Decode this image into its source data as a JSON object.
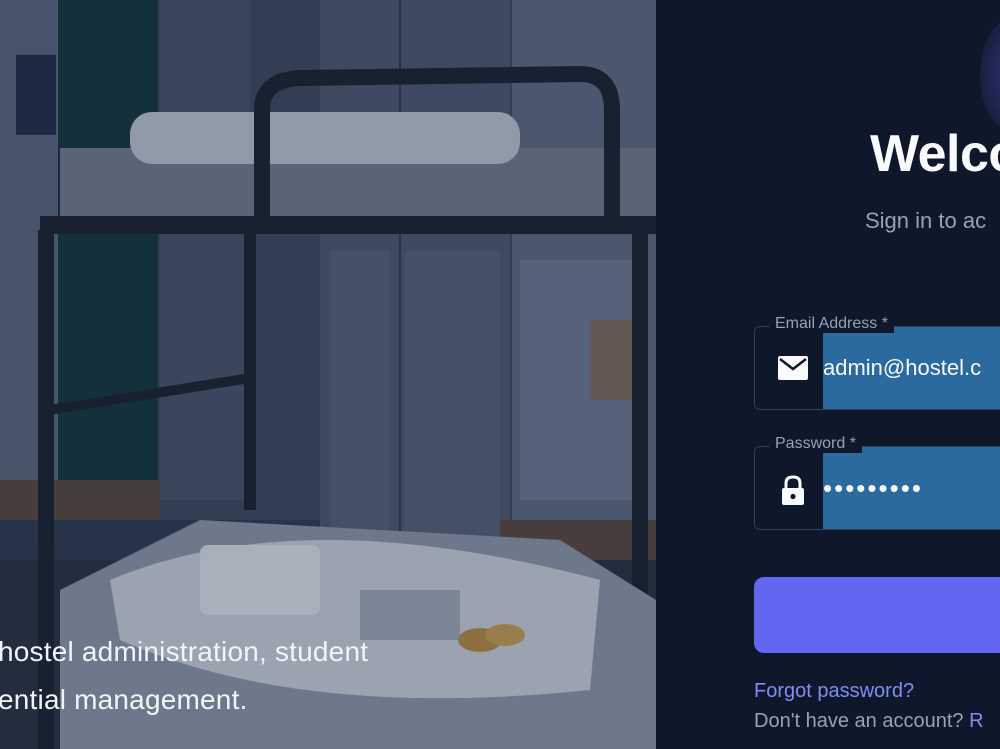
{
  "hero": {
    "caption_line1": "hostel administration, student",
    "caption_line2": "ential management."
  },
  "auth": {
    "title": "Welco",
    "subtitle": "Sign in to ac",
    "email": {
      "label": "Email Address *",
      "value": "admin@hostel.c",
      "icon": "mail-icon"
    },
    "password": {
      "label": "Password *",
      "value": "•••••••••",
      "icon": "lock-icon"
    },
    "submit_label": "",
    "forgot_label": "Forgot password?",
    "signup_prompt": "Don't have an account? ",
    "signup_link": "R"
  },
  "colors": {
    "panel_bg": "#0f172a",
    "accent": "#6366f1",
    "link": "#818cf8",
    "autofill": "#2b6a9e"
  }
}
